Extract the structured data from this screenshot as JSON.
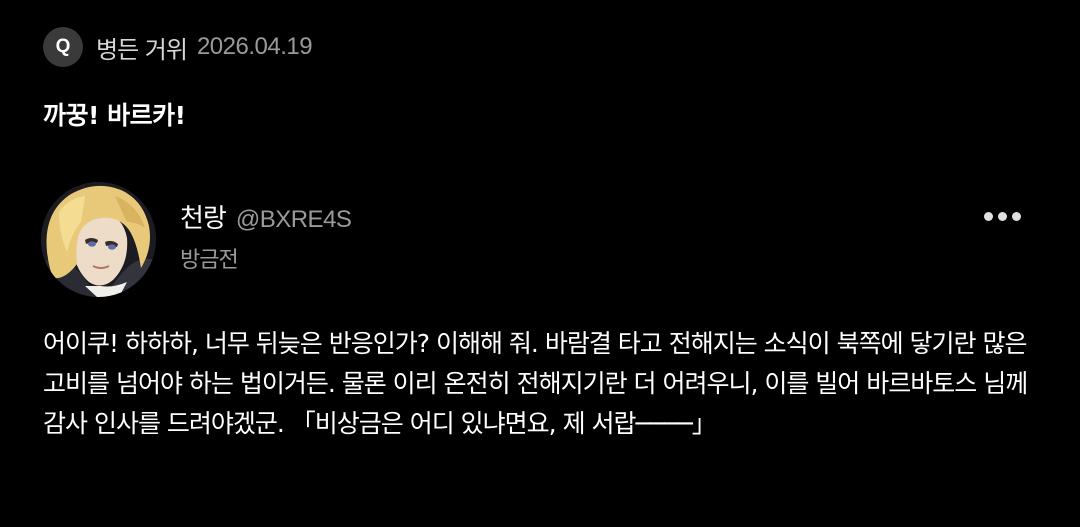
{
  "question": {
    "badge_label": "Q",
    "author": "병든 거위",
    "date": "2026.04.19",
    "text": "까꿍! 바르카!"
  },
  "reply": {
    "avatar_icon": "character-portrait-avatar",
    "name": "천랑",
    "handle": "@BXRE4S",
    "time": "방금전",
    "more_icon": "more-horizontal-icon",
    "body": "어이쿠! 하하하, 너무 뒤늦은 반응인가? 이해해 줘. 바람결 타고 전해지는 소식이 북쪽에 닿기란 많은 고비를 넘어야 하는 법이거든. 물론 이리 온전히 전해지기란 더 어려우니, 이를 빌어 바르바토스 님께 감사 인사를 드려야겠군. 「비상금은 어디 있냐면요, 제 서랍────」"
  },
  "colors": {
    "background": "#000000",
    "primary_text": "#ffffff",
    "secondary_text": "#9a9a9a",
    "badge_bg": "#3a3a3a"
  }
}
